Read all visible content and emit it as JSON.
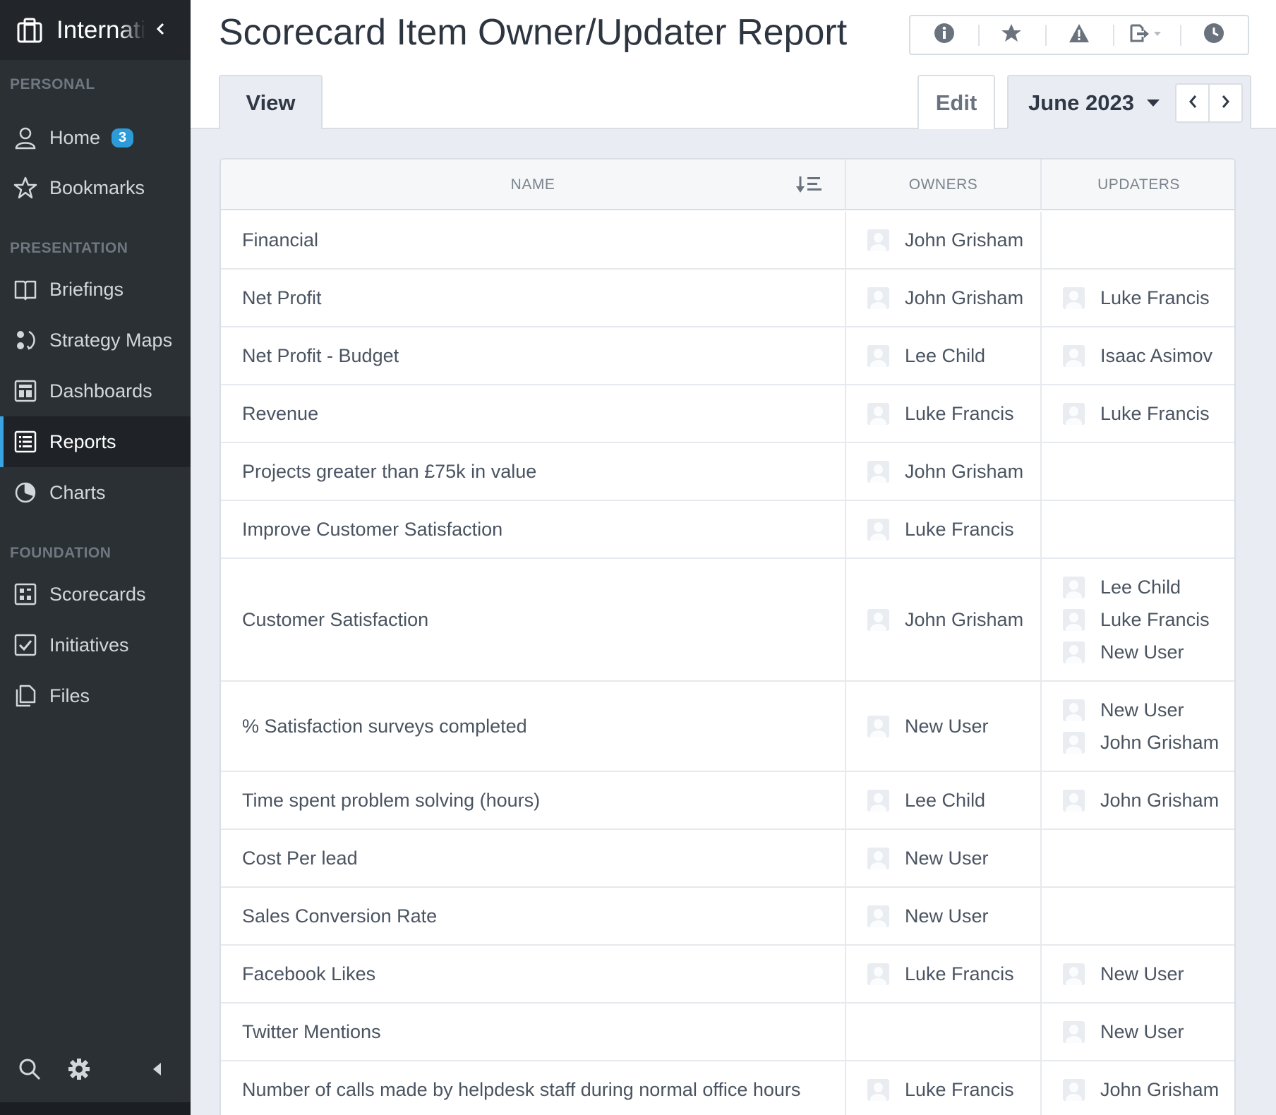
{
  "sidebar": {
    "org_name": "International",
    "sections": {
      "personal": "PERSONAL",
      "presentation": "PRESENTATION",
      "foundation": "FOUNDATION"
    },
    "items": {
      "home": {
        "label": "Home",
        "badge": "3",
        "icon": "user-icon"
      },
      "bookmarks": {
        "label": "Bookmarks",
        "icon": "star-icon"
      },
      "briefings": {
        "label": "Briefings",
        "icon": "book-icon"
      },
      "strategy_maps": {
        "label": "Strategy Maps",
        "icon": "strategy-map-icon"
      },
      "dashboards": {
        "label": "Dashboards",
        "icon": "dashboard-icon"
      },
      "reports": {
        "label": "Reports",
        "icon": "report-icon",
        "active": true
      },
      "charts": {
        "label": "Charts",
        "icon": "pie-chart-icon"
      },
      "scorecards": {
        "label": "Scorecards",
        "icon": "scorecard-icon"
      },
      "initiatives": {
        "label": "Initiatives",
        "icon": "checkbox-icon"
      },
      "files": {
        "label": "Files",
        "icon": "files-icon"
      }
    }
  },
  "header": {
    "title": "Scorecard Item Owner/Updater Report",
    "toolbar": [
      "info-icon",
      "star-icon",
      "warning-icon",
      "export-icon",
      "history-icon"
    ],
    "tabs": {
      "view": "View",
      "edit": "Edit"
    },
    "period": "June 2023"
  },
  "colors": {
    "sidebar_bg": "#2b3035",
    "accent": "#3aa3e3",
    "badge": "#2e9bd9"
  },
  "table": {
    "headers": {
      "name": "NAME",
      "owners": "OWNERS",
      "updaters": "UPDATERS"
    },
    "rows": [
      {
        "name": "Financial",
        "owners": [
          "John Grisham"
        ],
        "updaters": []
      },
      {
        "name": "Net Profit",
        "owners": [
          "John Grisham"
        ],
        "updaters": [
          "Luke Francis"
        ]
      },
      {
        "name": "Net Profit - Budget",
        "owners": [
          "Lee Child"
        ],
        "updaters": [
          "Isaac Asimov"
        ]
      },
      {
        "name": "Revenue",
        "owners": [
          "Luke Francis"
        ],
        "updaters": [
          "Luke Francis"
        ]
      },
      {
        "name": "Projects greater than £75k in value",
        "owners": [
          "John Grisham"
        ],
        "updaters": []
      },
      {
        "name": "Improve Customer Satisfaction",
        "owners": [
          "Luke Francis"
        ],
        "updaters": []
      },
      {
        "name": "Customer Satisfaction",
        "owners": [
          "John Grisham"
        ],
        "updaters": [
          "Lee Child",
          "Luke Francis",
          "New User"
        ]
      },
      {
        "name": "% Satisfaction surveys completed",
        "owners": [
          "New User"
        ],
        "updaters": [
          "New User",
          "John Grisham"
        ]
      },
      {
        "name": "Time spent problem solving (hours)",
        "owners": [
          "Lee Child"
        ],
        "updaters": [
          "John Grisham"
        ]
      },
      {
        "name": "Cost Per lead",
        "owners": [
          "New User"
        ],
        "updaters": []
      },
      {
        "name": "Sales Conversion Rate",
        "owners": [
          "New User"
        ],
        "updaters": []
      },
      {
        "name": "Facebook Likes",
        "owners": [
          "Luke Francis"
        ],
        "updaters": [
          "New User"
        ]
      },
      {
        "name": "Twitter Mentions",
        "owners": [],
        "updaters": [
          "New User"
        ]
      },
      {
        "name": "Number of calls made by helpdesk staff during normal office hours",
        "owners": [
          "Luke Francis"
        ],
        "updaters": [
          "John Grisham"
        ]
      }
    ]
  }
}
